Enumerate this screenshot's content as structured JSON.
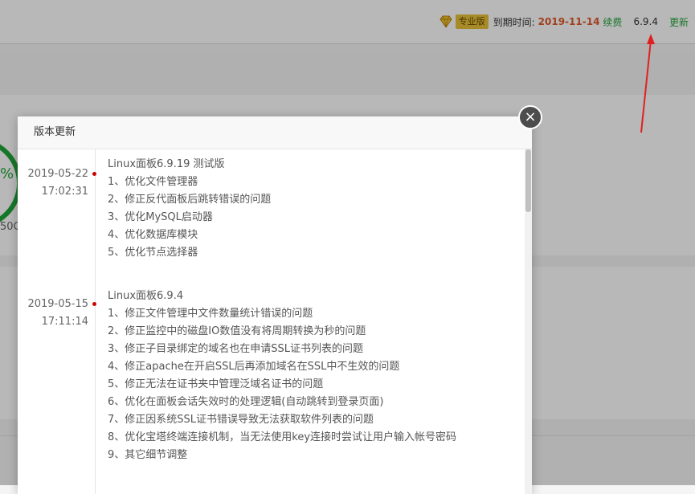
{
  "header": {
    "pro_label": "专业版",
    "expire_label": "到期时间:",
    "expire_date": "2019-11-14",
    "renew_label": "续费",
    "version": "6.9.4",
    "update_label": "更新"
  },
  "background": {
    "gauge_percent": "%",
    "gauge_caption": "50G"
  },
  "modal": {
    "title": "版本更新",
    "close_glyph": "×",
    "entries": [
      {
        "date": "2019-05-22",
        "time": "17:02:31",
        "title": "Linux面板6.9.19 测试版",
        "items": [
          "1、优化文件管理器",
          "2、修正反代面板后跳转错误的问题",
          "3、优化MySQL启动器",
          "4、优化数据库模块",
          "5、优化节点选择器"
        ]
      },
      {
        "date": "2019-05-15",
        "time": "17:11:14",
        "title": "Linux面板6.9.4",
        "items": [
          "1、修正文件管理中文件数量统计错误的问题",
          "2、修正监控中的磁盘IO数值没有将周期转换为秒的问题",
          "3、修正子目录绑定的域名也在申请SSL证书列表的问题",
          "4、修正apache在开启SSL后再添加域名在SSL中不生效的问题",
          "5、修正无法在证书夹中管理泛域名证书的问题",
          "6、优化在面板会话失效时的处理逻辑(自动跳转到登录页面)",
          "7、修正因系统SSL证书错误导致无法获取软件列表的问题",
          "8、优化宝塔终端连接机制，当无法使用key连接时尝试让用户输入帐号密码",
          "9、其它细节调整"
        ]
      }
    ]
  },
  "colors": {
    "accent_green": "#20a53a",
    "date_orange": "#e0582a",
    "badge_gold": "#e8c13a",
    "arrow_red": "#e02020",
    "dot_red": "#cc0000"
  }
}
